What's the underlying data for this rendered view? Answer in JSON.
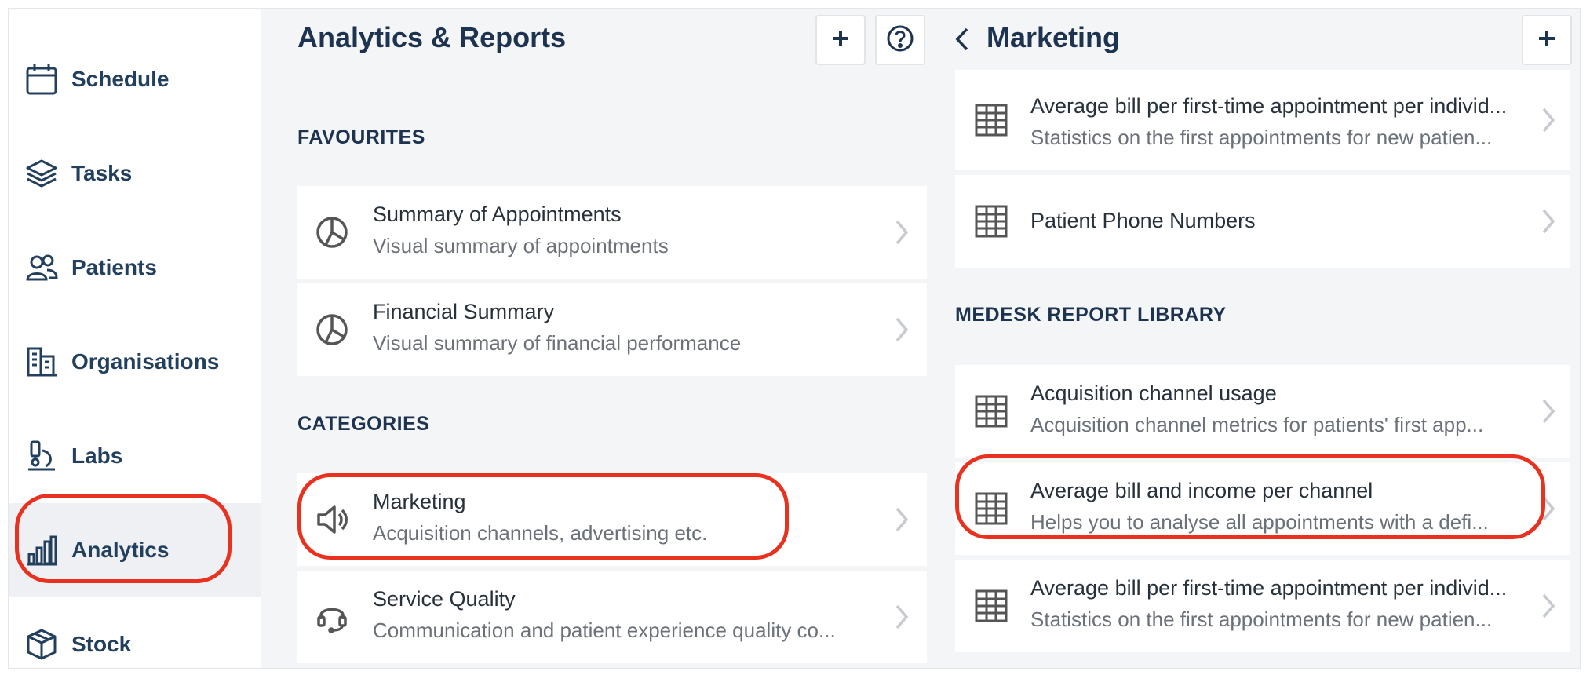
{
  "sidebar": {
    "items": [
      {
        "label": "Schedule",
        "icon": "calendar-icon"
      },
      {
        "label": "Tasks",
        "icon": "layers-icon"
      },
      {
        "label": "Patients",
        "icon": "users-icon"
      },
      {
        "label": "Organisations",
        "icon": "building-icon"
      },
      {
        "label": "Labs",
        "icon": "microscope-icon"
      },
      {
        "label": "Analytics",
        "icon": "bar-chart-icon",
        "active": true
      },
      {
        "label": "Stock",
        "icon": "box-icon"
      }
    ]
  },
  "middle": {
    "title": "Analytics & Reports",
    "favourites_title": "FAVOURITES",
    "favourites": [
      {
        "title": "Summary of Appointments",
        "subtitle": "Visual summary of appointments",
        "icon": "pie-chart-icon"
      },
      {
        "title": "Financial Summary",
        "subtitle": "Visual summary of financial performance",
        "icon": "pie-chart-icon"
      }
    ],
    "categories_title": "CATEGORIES",
    "categories": [
      {
        "title": "Marketing",
        "subtitle": "Acquisition channels, advertising etc.",
        "icon": "megaphone-icon"
      },
      {
        "title": "Service Quality",
        "subtitle": "Communication and patient experience quality co...",
        "icon": "headset-icon"
      }
    ]
  },
  "right": {
    "title": "Marketing",
    "top_items": [
      {
        "title": "Average bill per first-time appointment per individ...",
        "subtitle": "Statistics on the first appointments for new patien...",
        "icon": "table-icon"
      },
      {
        "title": "Patient Phone Numbers",
        "subtitle": "",
        "icon": "table-icon"
      }
    ],
    "library_title": "MEDESK REPORT LIBRARY",
    "library": [
      {
        "title": "Acquisition channel usage",
        "subtitle": "Acquisition channel metrics for patients' first app...",
        "icon": "table-icon"
      },
      {
        "title": "Average bill and income per channel",
        "subtitle": "Helps you to analyse all appointments with a defi...",
        "icon": "table-icon"
      },
      {
        "title": "Average bill per first-time appointment per individ...",
        "subtitle": "Statistics on the first appointments for new patien...",
        "icon": "table-icon"
      }
    ]
  },
  "colors": {
    "accent_highlight": "#e8321f",
    "nav_text": "#22405e",
    "heading": "#1d3350"
  }
}
